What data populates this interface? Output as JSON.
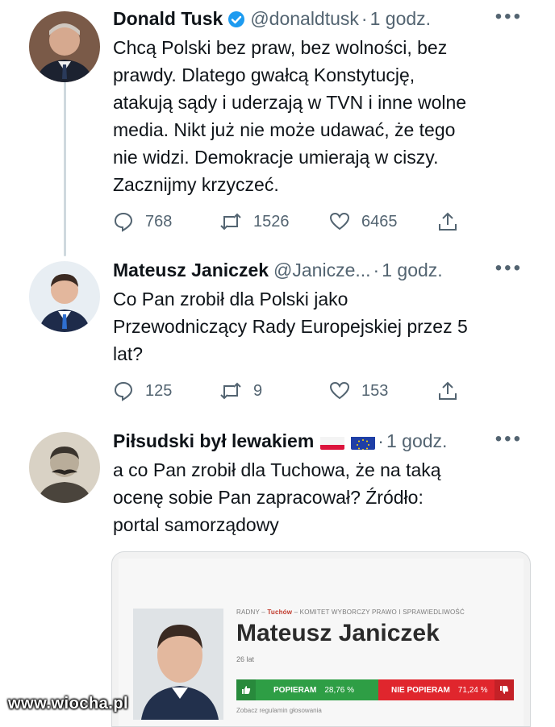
{
  "tweets": [
    {
      "name": "Donald Tusk",
      "handle": "@donaldtusk",
      "time": "1 godz.",
      "more": "•••",
      "text": "Chcą Polski bez praw, bez wolności, bez\nprawdy. Dlatego gwałcą Konstytucję,\natakują sądy i uderzają w TVN i inne wolne\nmedia. Nikt już nie może udawać, że tego\nnie widzi. Demokracje umierają w ciszy.\nZacznijmy krzyczeć.",
      "replies": "768",
      "retweets": "1526",
      "likes": "6465"
    },
    {
      "name": "Mateusz Janiczek",
      "handle": "@Janicze...",
      "time": "1 godz.",
      "more": "•••",
      "text": "Co Pan zrobił dla Polski jako\nPrzewodniczący Rady Europejskiej przez 5\nlat?",
      "replies": "125",
      "retweets": "9",
      "likes": "153"
    },
    {
      "name": "Piłsudski był lewakiem",
      "time": "1 godz.",
      "more": "•••",
      "text": "a co Pan zrobił dla Tuchowa, że na taką\nocenę sobie Pan zapracował? Źródło:\nportal samorządowy"
    }
  ],
  "card": {
    "meta_prefix": "RADNY – ",
    "meta_town": "Tuchów",
    "meta_suffix": " – KOMITET WYBORCZY PRAWO I SPRAWIEDLIWOŚĆ",
    "name": "Mateusz Janiczek",
    "age": "26 lat",
    "support_label": "POPIERAM",
    "support_pct": "28,76 %",
    "oppose_label": "NIE POPIERAM",
    "oppose_pct": "71,24 %",
    "rules": "Zobacz regulamin głosowania"
  },
  "watermark": "www.wiocha.pl",
  "colors": {
    "verified": "#1d9bf0",
    "support": "#2e9e45",
    "oppose": "#e0262d"
  }
}
